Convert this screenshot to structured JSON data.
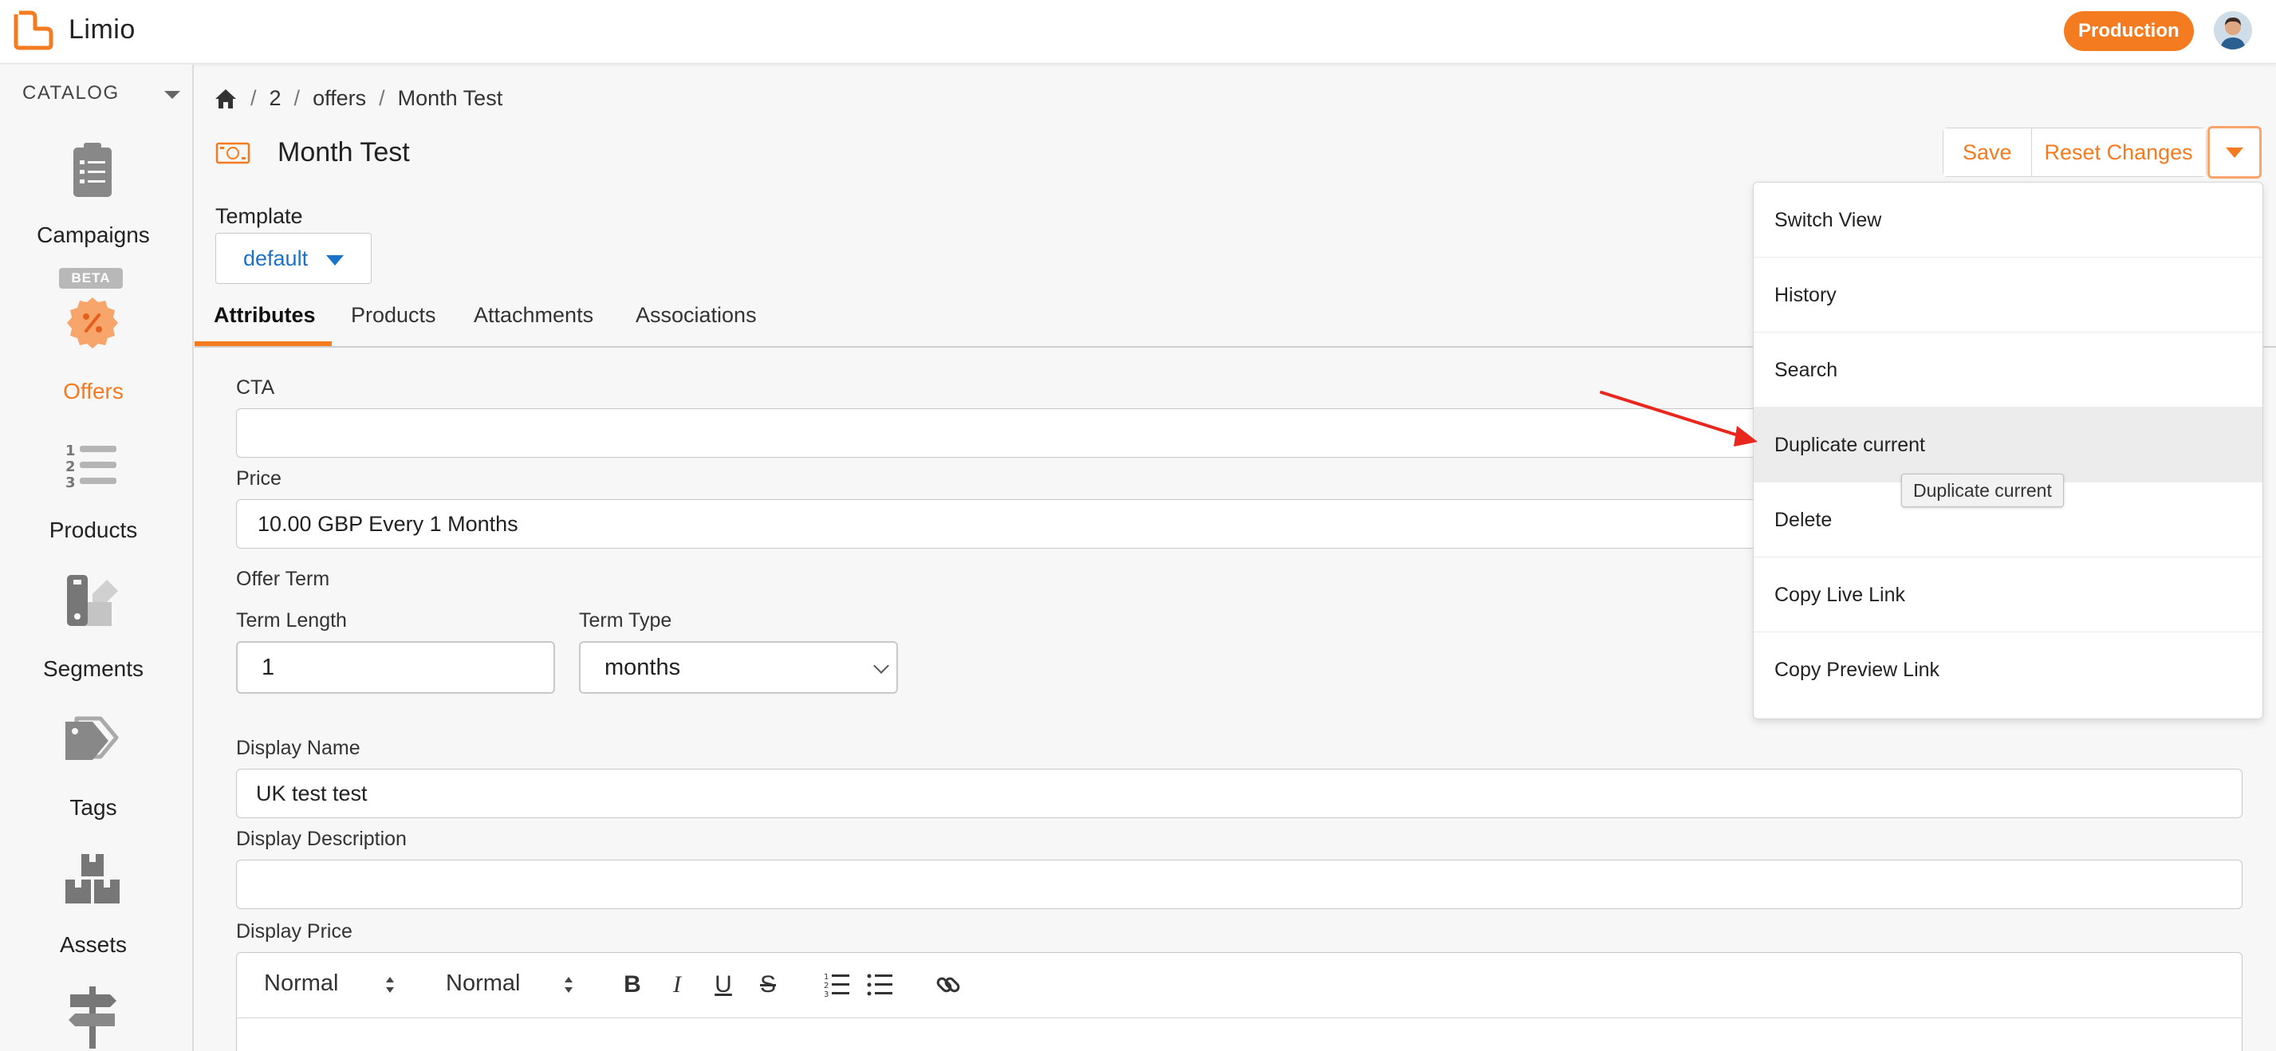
{
  "app": {
    "name": "Limio",
    "environment": "Production"
  },
  "colors": {
    "accent": "#f47b20",
    "link": "#1a73c8",
    "annotation_arrow": "#e8281e"
  },
  "sidebar": {
    "section": "CATALOG",
    "items": [
      {
        "label": "Campaigns",
        "icon": "clipboard-icon"
      },
      {
        "label": "Offers",
        "icon": "discount-badge-icon",
        "badge": "BETA",
        "active": true
      },
      {
        "label": "Products",
        "icon": "numbered-list-icon"
      },
      {
        "label": "Segments",
        "icon": "swatch-icon"
      },
      {
        "label": "Tags",
        "icon": "tag-icon"
      },
      {
        "label": "Assets",
        "icon": "boxes-icon"
      },
      {
        "label": "",
        "icon": "signpost-icon"
      }
    ]
  },
  "breadcrumb": {
    "items": [
      "2",
      "offers",
      "Month Test"
    ]
  },
  "page": {
    "title": "Month Test"
  },
  "actions": {
    "save": "Save",
    "reset": "Reset Changes"
  },
  "template": {
    "label": "Template",
    "value": "default"
  },
  "tabs": [
    "Attributes",
    "Products",
    "Attachments",
    "Associations"
  ],
  "form": {
    "cta": {
      "label": "CTA",
      "value": ""
    },
    "price": {
      "label": "Price",
      "value": "10.00 GBP Every 1 Months"
    },
    "offer_term": {
      "label": "Offer Term"
    },
    "term_length": {
      "label": "Term Length",
      "value": "1"
    },
    "term_type": {
      "label": "Term Type",
      "value": "months"
    },
    "display_name": {
      "label": "Display Name",
      "value": "UK test test"
    },
    "display_description": {
      "label": "Display Description",
      "value": ""
    },
    "display_price": {
      "label": "Display Price"
    }
  },
  "editor": {
    "format1": "Normal",
    "format2": "Normal"
  },
  "menu": {
    "items": [
      "Switch View",
      "History",
      "Search",
      "Duplicate current",
      "Delete",
      "Copy Live Link",
      "Copy Preview Link"
    ],
    "hovered": "Duplicate current",
    "tooltip": "Duplicate current"
  }
}
